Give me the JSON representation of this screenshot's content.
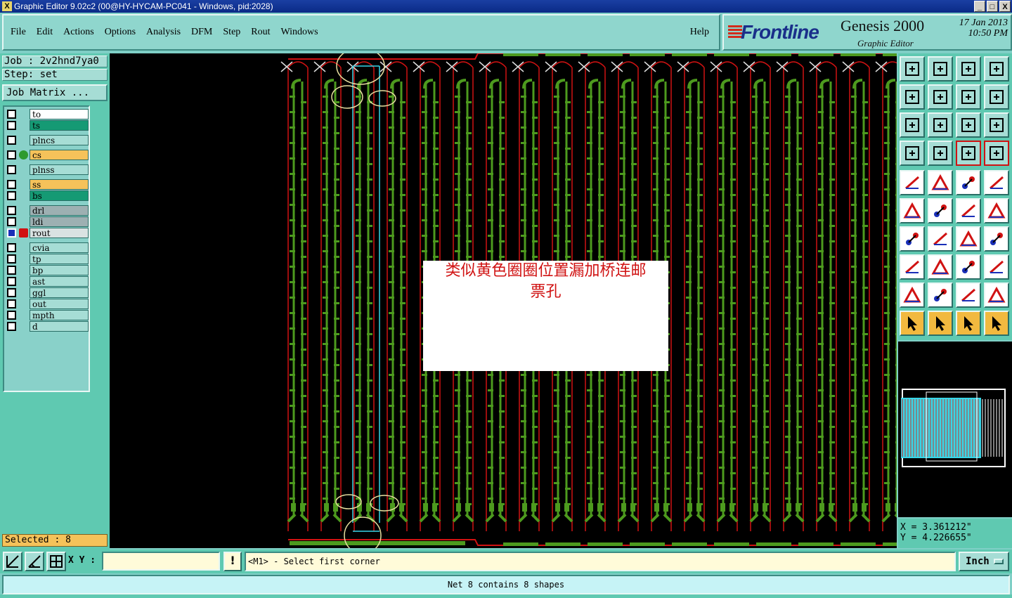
{
  "window": {
    "title": "Graphic Editor 9.02c2 (00@HY-HYCAM-PC041 - Windows, pid:2028)",
    "buttons": [
      "_",
      "□",
      "X"
    ]
  },
  "menubar": {
    "items": [
      "File",
      "Edit",
      "Actions",
      "Options",
      "Analysis",
      "DFM",
      "Step",
      "Rout",
      "Windows"
    ],
    "help": "Help"
  },
  "logo": {
    "brand": "Frontline",
    "product": "Genesis 2000",
    "subtitle": "Graphic Editor",
    "date_line1": "17 Jan 2013",
    "date_line2": "10:50 PM"
  },
  "job": {
    "job_line": "Job : 2v2hnd7ya0",
    "step_line": "Step: set",
    "matrix_button": "Job Matrix ..."
  },
  "layers": [
    {
      "name": "to",
      "color": "#ffffff",
      "group": 0
    },
    {
      "name": "ts",
      "color": "#159a74",
      "group": 0
    },
    {
      "name": "plncs",
      "color": "#a6ddd5",
      "group": 1
    },
    {
      "name": "cs",
      "color": "#f5c25a",
      "group": 2,
      "dot": "#2e9a2e"
    },
    {
      "name": "plnss",
      "color": "#a6ddd5",
      "group": 3
    },
    {
      "name": "ss",
      "color": "#f5c25a",
      "group": 4
    },
    {
      "name": "bs",
      "color": "#159a74",
      "group": 4
    },
    {
      "name": "drl",
      "color": "#9db0b2",
      "group": 5
    },
    {
      "name": "ldi",
      "color": "#9db0b2",
      "group": 5
    },
    {
      "name": "rout",
      "color": "#d9e2e2",
      "group": 5,
      "active": true
    },
    {
      "name": "cvia",
      "color": "#a6ddd5",
      "group": 6
    },
    {
      "name": "tp",
      "color": "#a6ddd5",
      "group": 6
    },
    {
      "name": "bp",
      "color": "#a6ddd5",
      "group": 6
    },
    {
      "name": "ast",
      "color": "#a6ddd5",
      "group": 6
    },
    {
      "name": "ggl",
      "color": "#a6ddd5",
      "group": 6
    },
    {
      "name": "out",
      "color": "#a6ddd5",
      "group": 6
    },
    {
      "name": "mpth",
      "color": "#a6ddd5",
      "group": 6
    },
    {
      "name": "d",
      "color": "#a6ddd5",
      "group": 6
    }
  ],
  "selected": "Selected : 8",
  "note": {
    "line1": "类似黄色圈圈位置漏加桥连邮",
    "line2": "票孔"
  },
  "coords": {
    "x": "X = 3.361212\"",
    "y": "Y = 4.226655\""
  },
  "bottombar": {
    "xy_label": "X Y :",
    "xy_value": "",
    "warn": "!",
    "prompt": "<M1> - Select first corner",
    "unit": "Inch"
  },
  "status": "Net 8 contains 8 shapes",
  "colors": {
    "board_green": "#4d9a1e",
    "rout_red": "#d01212",
    "highlight_cyan": "#38d6e8",
    "circle_yellow": "#e8e0a0"
  }
}
